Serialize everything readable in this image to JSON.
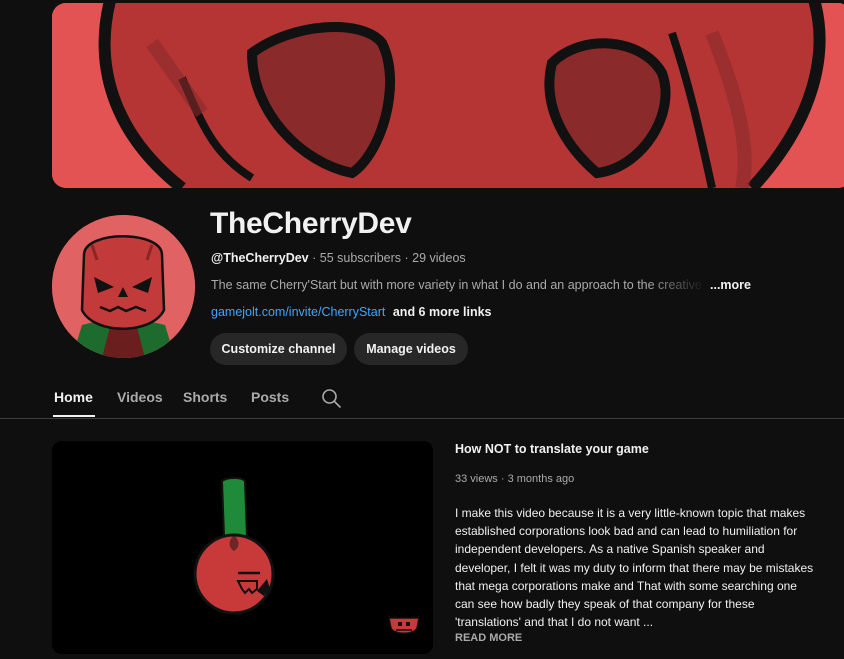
{
  "channel": {
    "name": "TheCherryDev",
    "handle": "@TheCherryDev",
    "stats": "· 55 subscribers · 29 videos",
    "description": "The same Cherry'Start but with more variety in what I do and an approach to the creative",
    "more_label": "...more",
    "link": "gamejolt.com/invite/CherryStart",
    "more_links": "and 6 more links"
  },
  "actions": {
    "customize_label": "Customize channel",
    "manage_label": "Manage videos"
  },
  "tabs": [
    {
      "label": "Home",
      "active": true
    },
    {
      "label": "Videos",
      "active": false
    },
    {
      "label": "Shorts",
      "active": false
    },
    {
      "label": "Posts",
      "active": false
    }
  ],
  "icons": {
    "search": "search-icon"
  },
  "video": {
    "title": "How NOT to translate your game",
    "meta": "33 views · 3 months ago",
    "description": "I make this video because it is a very little-known topic that makes established corporations look bad and can lead to humiliation for independent developers. As a native Spanish speaker and developer, I felt it was my duty to inform that there may be mistakes that mega corporations make and That with some searching one can see how badly they speak of that company for these 'translations' and that I do not want ...",
    "read_more": "READ MORE"
  },
  "colors": {
    "background": "#0f0f0f",
    "banner": "#e35353",
    "link": "#3ea6ff",
    "cherry_red": "#c83a3a",
    "stem_green": "#1f8a3a"
  }
}
